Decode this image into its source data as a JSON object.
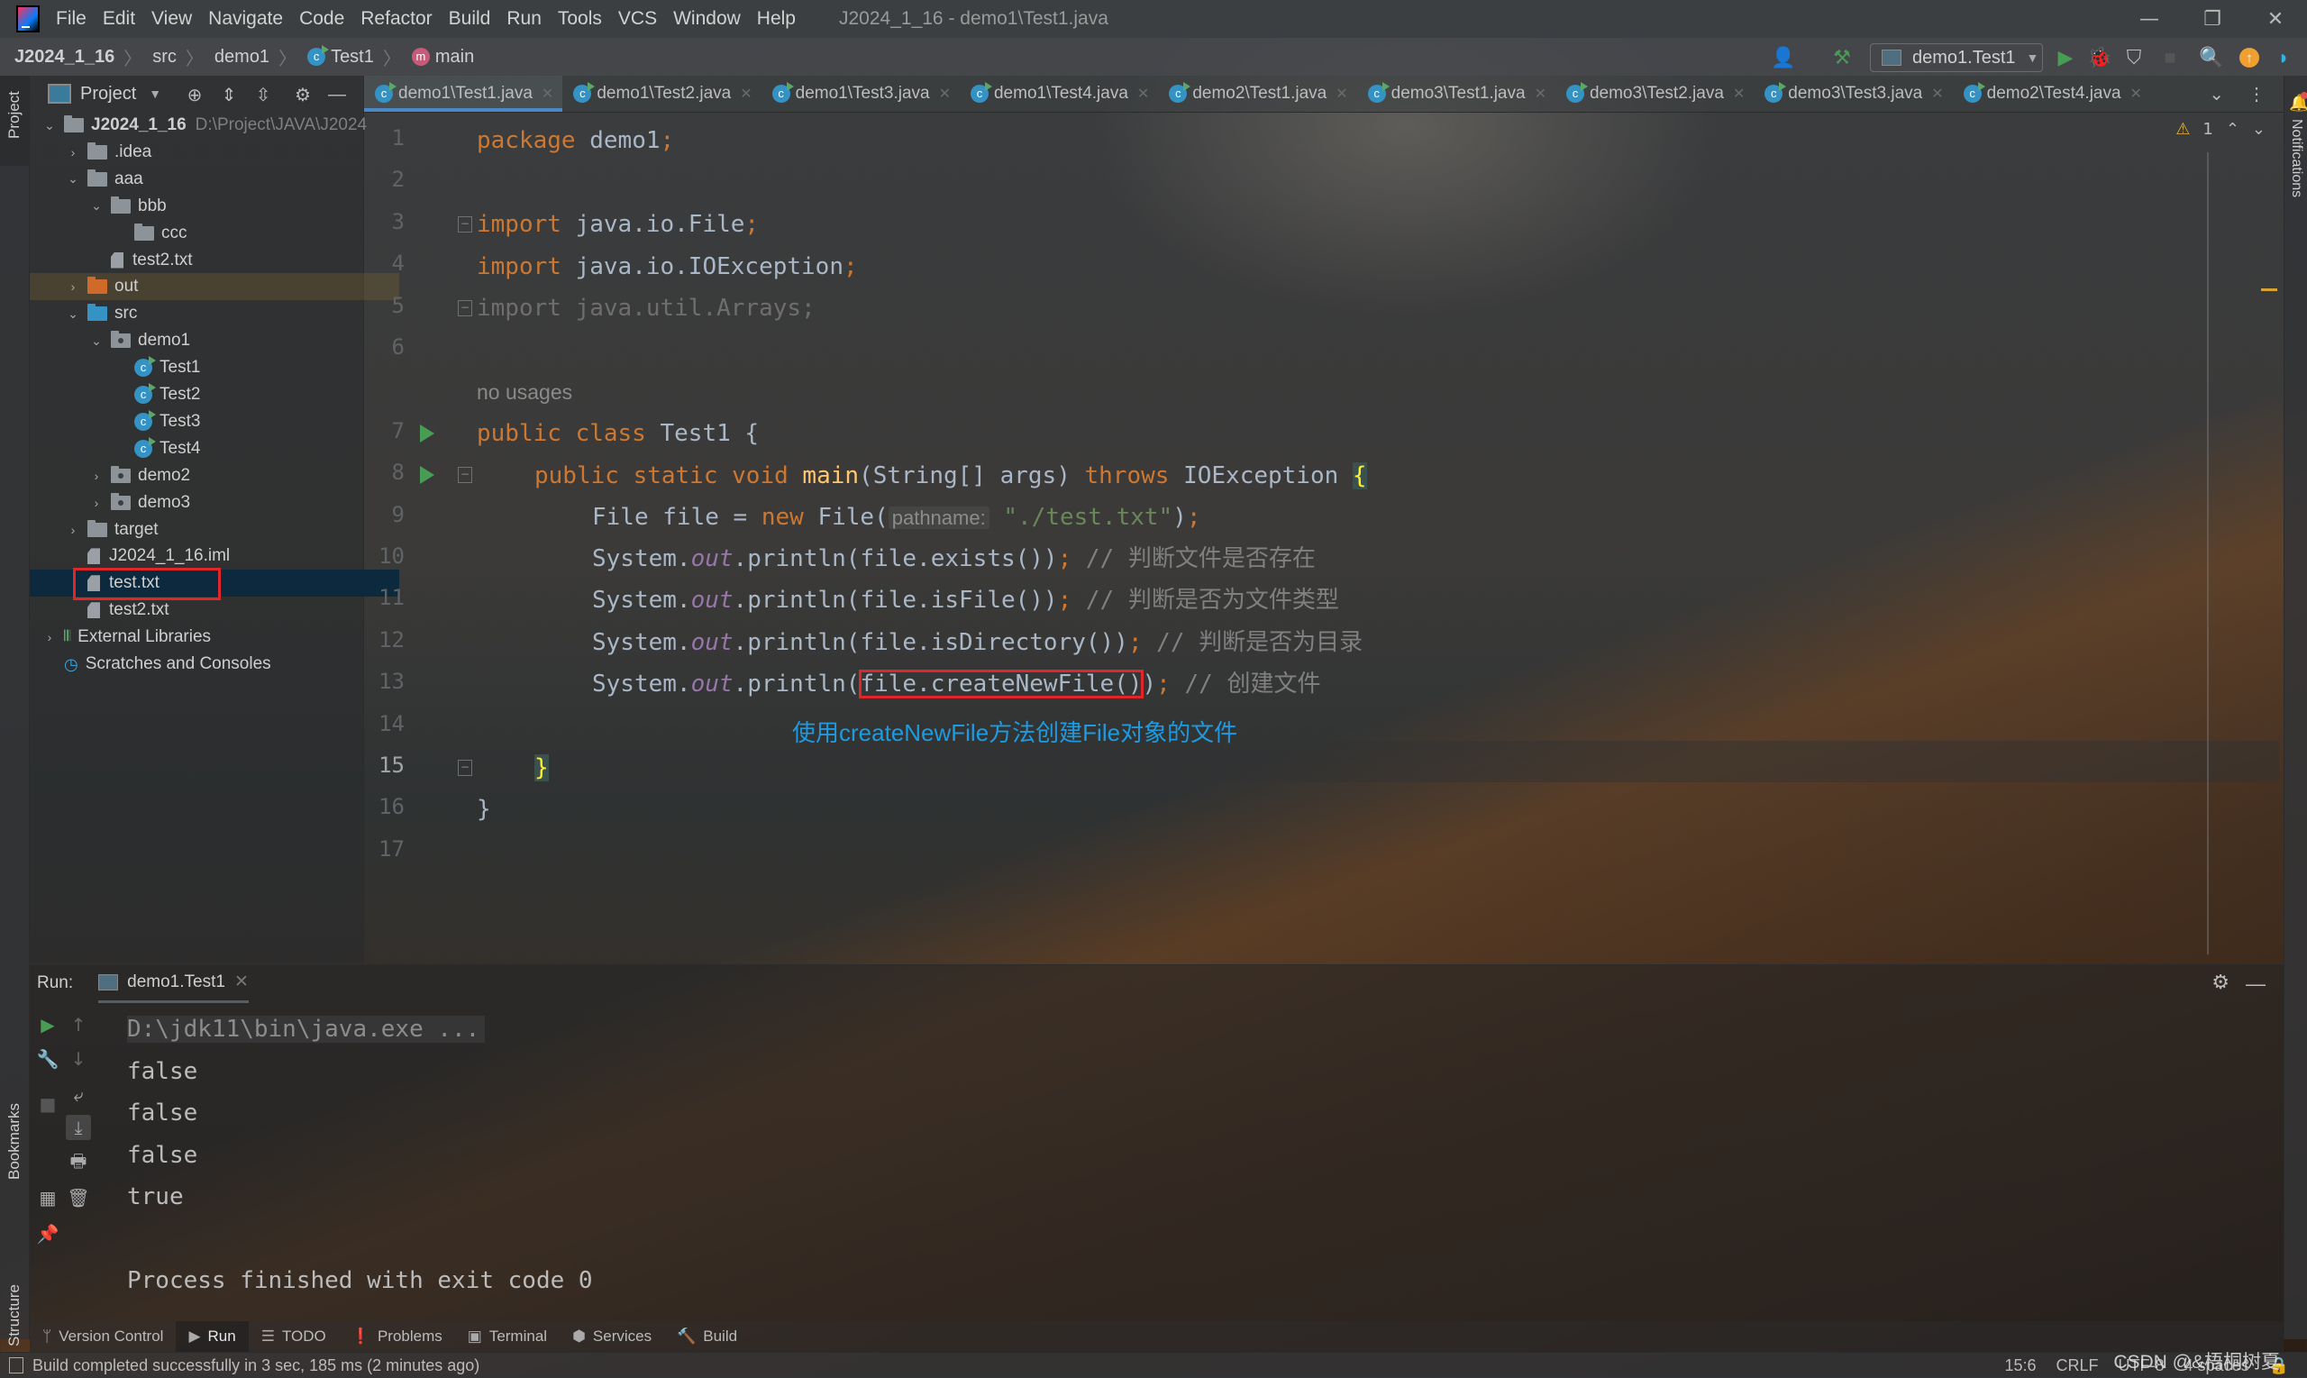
{
  "titlebar": {
    "menu": [
      "File",
      "Edit",
      "View",
      "Navigate",
      "Code",
      "Refactor",
      "Build",
      "Run",
      "Tools",
      "VCS",
      "Window",
      "Help"
    ],
    "window_title": "J2024_1_16 - demo1\\Test1.java",
    "minimize": "—",
    "restore": "❐",
    "close": "✕"
  },
  "navbar": {
    "breadcrumbs": [
      "J2024_1_16",
      "src",
      "demo1",
      "Test1",
      "main"
    ],
    "run_config": "demo1.Test1"
  },
  "left_strip": {
    "project_tab": "Project",
    "bookmarks_tab": "Bookmarks",
    "structure_tab": "Structure"
  },
  "right_strip": {
    "notifications_tab": "Notifications"
  },
  "project_panel": {
    "title": "Project",
    "tree": [
      {
        "label": "J2024_1_16",
        "hint": "D:\\Project\\JAVA\\J2024",
        "depth": 0,
        "icon": "module",
        "expanded": true
      },
      {
        "label": ".idea",
        "depth": 1,
        "icon": "folder",
        "expanded": false
      },
      {
        "label": "aaa",
        "depth": 1,
        "icon": "folder",
        "expanded": true
      },
      {
        "label": "bbb",
        "depth": 2,
        "icon": "folder",
        "expanded": true
      },
      {
        "label": "ccc",
        "depth": 3,
        "icon": "folder",
        "leaf": true
      },
      {
        "label": "test2.txt",
        "depth": 2,
        "icon": "file",
        "leaf": true
      },
      {
        "label": "out",
        "depth": 1,
        "icon": "folder-orange",
        "expanded": false
      },
      {
        "label": "src",
        "depth": 1,
        "icon": "folder-blue",
        "expanded": true
      },
      {
        "label": "demo1",
        "depth": 2,
        "icon": "package",
        "expanded": true
      },
      {
        "label": "Test1",
        "depth": 3,
        "icon": "class",
        "leaf": true
      },
      {
        "label": "Test2",
        "depth": 3,
        "icon": "class",
        "leaf": true
      },
      {
        "label": "Test3",
        "depth": 3,
        "icon": "class",
        "leaf": true
      },
      {
        "label": "Test4",
        "depth": 3,
        "icon": "class",
        "leaf": true
      },
      {
        "label": "demo2",
        "depth": 2,
        "icon": "package",
        "expanded": false
      },
      {
        "label": "demo3",
        "depth": 2,
        "icon": "package",
        "expanded": false
      },
      {
        "label": "target",
        "depth": 1,
        "icon": "folder",
        "expanded": false
      },
      {
        "label": "J2024_1_16.iml",
        "depth": 1,
        "icon": "file",
        "leaf": true
      },
      {
        "label": "test.txt",
        "depth": 1,
        "icon": "file",
        "leaf": true,
        "selected": true
      },
      {
        "label": "test2.txt",
        "depth": 1,
        "icon": "file",
        "leaf": true
      },
      {
        "label": "External Libraries",
        "depth": 0,
        "icon": "libraries",
        "expanded": false
      },
      {
        "label": "Scratches and Consoles",
        "depth": 0,
        "icon": "scratches",
        "leaf": true
      }
    ]
  },
  "editor": {
    "tabs": [
      "demo1\\Test1.java",
      "demo1\\Test2.java",
      "demo1\\Test3.java",
      "demo1\\Test4.java",
      "demo2\\Test1.java",
      "demo3\\Test1.java",
      "demo3\\Test2.java",
      "demo3\\Test3.java",
      "demo2\\Test4.java"
    ],
    "active_tab": 0,
    "warnings_count": "1",
    "no_usages": "no usages",
    "line_numbers": [
      "1",
      "2",
      "3",
      "4",
      "5",
      "6",
      "7",
      "8",
      "9",
      "10",
      "11",
      "12",
      "13",
      "14",
      "15",
      "16",
      "17"
    ],
    "current_line": "15",
    "code": {
      "l1_kw": "package",
      "l1_rest": " demo1",
      "semi": ";",
      "import_kw": "import",
      "l3": " java.io.File",
      "l4": " java.io.IOException",
      "l5": "import java.util.Arrays;",
      "l7_kw": "public class",
      "l7_rest": " Test1 {",
      "l8_kw": "public static void",
      "l8_fn": "main",
      "l8_mid": "(String[] args) ",
      "l8_throws": "throws",
      "l8_exc": " IOException ",
      "l8_brace": "{",
      "l9_a": "File file = ",
      "l9_new": "new",
      "l9_b": " File(",
      "l9_hint": "pathname:",
      "l9_str": "\"./test.txt\"",
      "l9_end": ")",
      "sys": "System.",
      "out": "out",
      "println": ".println(",
      "l10_arg": "file.exists())",
      "l10_cmt": "// 判断文件是否存在",
      "l11_arg": "file.isFile())",
      "l11_cmt": "// 判断是否为文件类型",
      "l12_arg": "file.isDirectory())",
      "l12_cmt": "// 判断是否为目录",
      "l13_arg": "file.createNewFile()",
      "l13_close": ")",
      "l13_cmt": "// 创建文件",
      "l15": "}",
      "l16": "}"
    },
    "annotation": "使用createNewFile方法创建File对象的文件"
  },
  "run_panel": {
    "label": "Run:",
    "tab": "demo1.Test1",
    "console": [
      "D:\\jdk11\\bin\\java.exe ...",
      "false",
      "false",
      "false",
      "true",
      "",
      "Process finished with exit code 0"
    ]
  },
  "bottom_tabs": [
    {
      "label": "Version Control",
      "icon": "ᛘ"
    },
    {
      "label": "Run",
      "icon": "▶",
      "active": true
    },
    {
      "label": "TODO",
      "icon": "☰"
    },
    {
      "label": "Problems",
      "icon": "❗"
    },
    {
      "label": "Terminal",
      "icon": "▣"
    },
    {
      "label": "Services",
      "icon": "⬢"
    },
    {
      "label": "Build",
      "icon": "🔨"
    }
  ],
  "statusbar": {
    "message": "Build completed successfully in 3 sec, 185 ms (2 minutes ago)",
    "position": "15:6",
    "line_sep": "CRLF",
    "encoding": "UTF-8",
    "indent": "4 spaces"
  },
  "watermark": "CSDN @&梧桐树夏",
  "colors": {
    "accent": "#4a88c7",
    "run_green": "#499c54",
    "annotation_blue": "#1e9ae0",
    "highlight_red": "#e0262a"
  }
}
